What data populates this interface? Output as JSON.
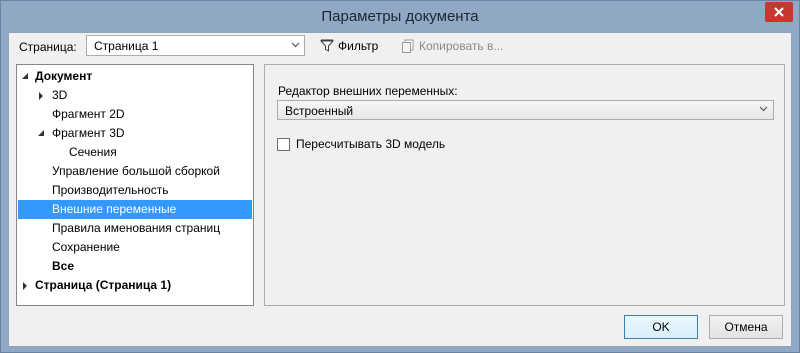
{
  "window": {
    "title": "Параметры документа"
  },
  "toolbar": {
    "page_label": "Страница:",
    "page_select_value": "Страница 1",
    "filter_label": "Фильтр",
    "copy_label": "Копировать в..."
  },
  "tree": {
    "items": [
      {
        "label": "Документ",
        "bold": true,
        "expander": "expanded"
      },
      {
        "label": "3D",
        "bold": false,
        "expander": "collapsed"
      },
      {
        "label": "Фрагмент 2D",
        "bold": false,
        "expander": "none"
      },
      {
        "label": "Фрагмент 3D",
        "bold": false,
        "expander": "expanded"
      },
      {
        "label": "Сечения",
        "bold": false,
        "expander": "none"
      },
      {
        "label": "Управление большой сборкой",
        "bold": false,
        "expander": "none"
      },
      {
        "label": "Производительность",
        "bold": false,
        "expander": "none"
      },
      {
        "label": "Внешние переменные",
        "bold": false,
        "expander": "none",
        "selected": true
      },
      {
        "label": "Правила именования страниц",
        "bold": false,
        "expander": "none"
      },
      {
        "label": "Сохранение",
        "bold": false,
        "expander": "none"
      },
      {
        "label": "Все",
        "bold": true,
        "expander": "none"
      },
      {
        "label": "Страница (Страница 1)",
        "bold": true,
        "expander": "collapsed"
      }
    ]
  },
  "panel": {
    "editor_label": "Редактор внешних переменных:",
    "editor_value": "Встроенный",
    "recalc_label": "Пересчитывать 3D модель",
    "recalc_checked": false
  },
  "buttons": {
    "ok": "OK",
    "cancel": "Отмена"
  },
  "colors": {
    "selection": "#3399ff",
    "frame": "#90a8c4",
    "close": "#c7372f"
  }
}
